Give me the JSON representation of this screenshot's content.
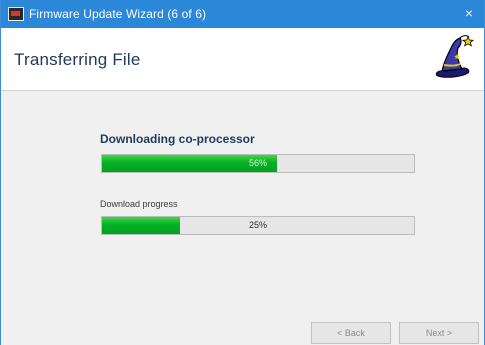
{
  "window": {
    "title": "Firmware Update Wizard (6 of 6)",
    "close_glyph": "×"
  },
  "header": {
    "title": "Transferring File",
    "icon": "wizard-hat-icon"
  },
  "coprocessor": {
    "label": "Downloading co-processor",
    "percent_text": "56%",
    "progress": 0.56
  },
  "download": {
    "label": "Download progress",
    "percent_text": "25%",
    "progress": 0.25
  },
  "footer": {
    "back_label": "< Back",
    "next_label": "Next >"
  },
  "colors": {
    "titlebar": "#2b88d8",
    "progress_fill": "#06b025",
    "header_text": "#1e3a57"
  }
}
